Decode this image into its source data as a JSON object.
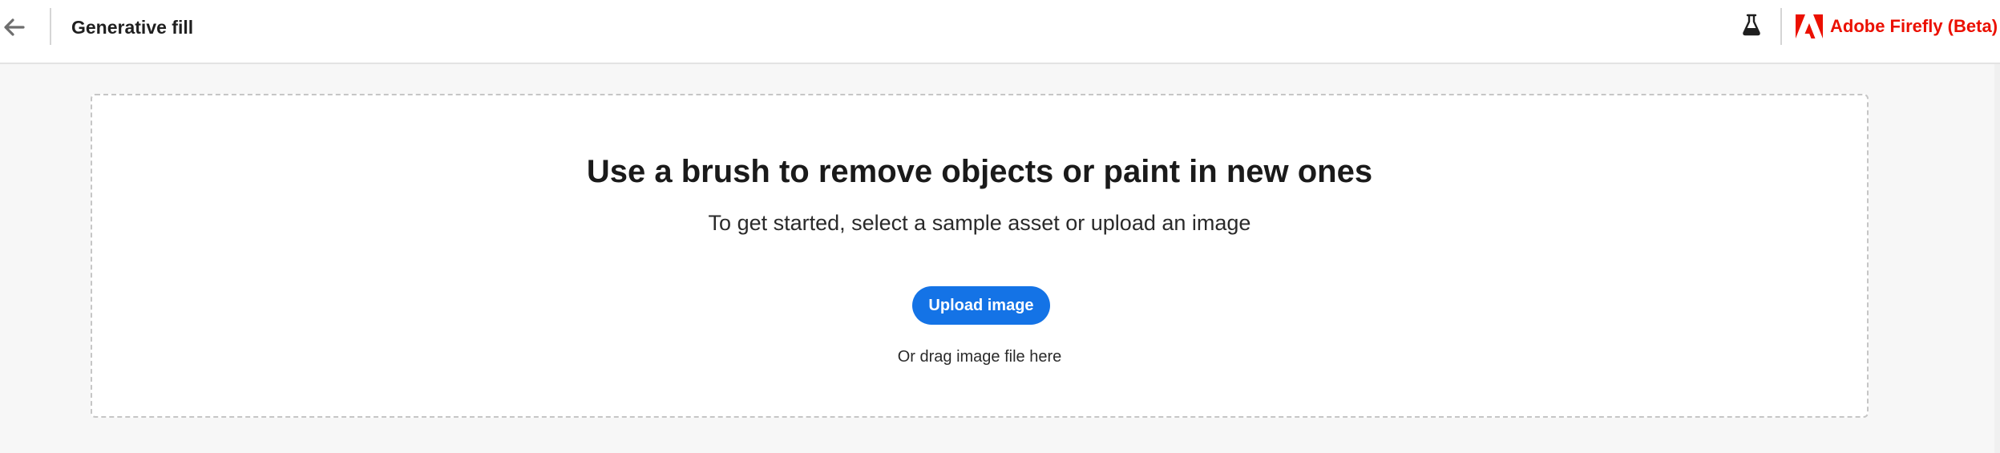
{
  "header": {
    "back_icon": "arrow-left-icon",
    "title": "Generative fill",
    "labs_icon": "flask-icon",
    "brand_icon": "adobe-logo-icon",
    "brand_name": "Adobe Firefly (Beta)",
    "brand_color": "#eb1000"
  },
  "dropzone": {
    "title": "Use a brush to remove objects or paint in new ones",
    "subtitle": "To get started, select a sample asset or upload an image",
    "upload_label": "Upload image",
    "upload_color": "#1473e6",
    "drag_hint": "Or drag image file here"
  }
}
